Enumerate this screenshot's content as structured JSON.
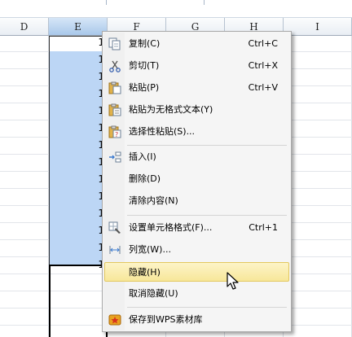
{
  "columns": {
    "D": "D",
    "E": "E",
    "F": "F",
    "G": "G",
    "H": "H",
    "I": "I"
  },
  "cell_values": [
    "1",
    "1",
    "1",
    "1",
    "1",
    "1",
    "1",
    "1",
    "1",
    "1",
    "1",
    "1",
    "1",
    "1"
  ],
  "context_menu": {
    "items": [
      {
        "label": "复制(C)",
        "shortcut": "Ctrl+C",
        "icon": "copy-icon"
      },
      {
        "label": "剪切(T)",
        "shortcut": "Ctrl+X",
        "icon": "scissors-icon"
      },
      {
        "label": "粘贴(P)",
        "shortcut": "Ctrl+V",
        "icon": "paste-icon"
      },
      {
        "label": "粘贴为无格式文本(Y)",
        "shortcut": "",
        "icon": "paste-text-icon"
      },
      {
        "label": "选择性粘贴(S)...",
        "shortcut": "",
        "icon": "paste-special-icon"
      },
      {
        "label": "插入(I)",
        "shortcut": "",
        "icon": "insert-icon"
      },
      {
        "label": "删除(D)",
        "shortcut": "",
        "icon": ""
      },
      {
        "label": "清除内容(N)",
        "shortcut": "",
        "icon": ""
      },
      {
        "label": "设置单元格格式(F)...",
        "shortcut": "Ctrl+1",
        "icon": "format-cells-icon"
      },
      {
        "label": "列宽(W)...",
        "shortcut": "",
        "icon": "column-width-icon"
      },
      {
        "label": "隐藏(H)",
        "shortcut": "",
        "icon": ""
      },
      {
        "label": "取消隐藏(U)",
        "shortcut": "",
        "icon": ""
      },
      {
        "label": "保存到WPS素材库",
        "shortcut": "",
        "icon": "wps-library-icon"
      }
    ],
    "highlighted": "隐藏(H)"
  },
  "colors": {
    "selection": "#bcd6f5",
    "highlight": "#f7e79a",
    "header_selected": "#a9c8ea"
  }
}
